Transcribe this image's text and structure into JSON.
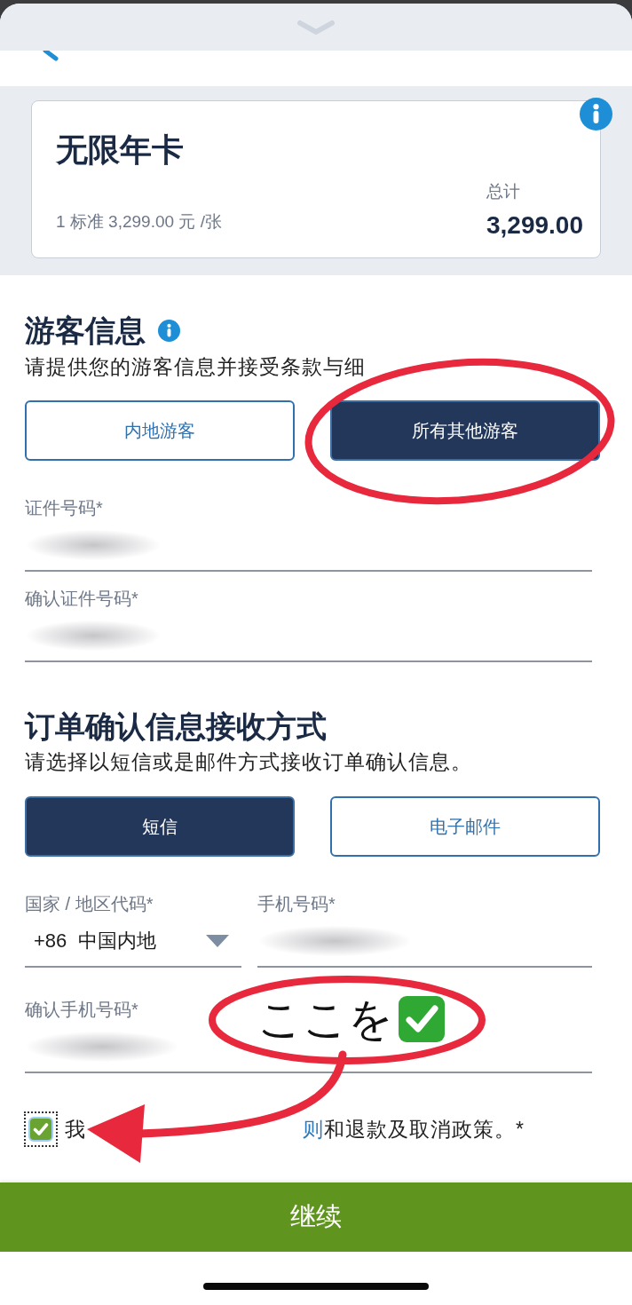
{
  "product_card": {
    "title": "无限年卡",
    "detail": "1 标准 3,299.00 元 /张",
    "total_label": "总计",
    "total": "3,299.00"
  },
  "guest_info": {
    "title": "游客信息",
    "subtitle": "请提供您的游客信息并接受条款与细",
    "options": [
      {
        "label": "内地游客",
        "selected": false
      },
      {
        "label": "所有其他游客",
        "selected": true
      }
    ],
    "fields": [
      {
        "label": "证件号码*",
        "value_redacted": true
      },
      {
        "label": "确认证件号码*",
        "value_redacted": true
      }
    ]
  },
  "confirmation": {
    "title": "订单确认信息接收方式",
    "subtitle": "请选择以短信或是邮件方式接收订单确认信息。",
    "options": [
      {
        "label": "短信",
        "selected": true
      },
      {
        "label": "电子邮件",
        "selected": false
      }
    ],
    "country_code": {
      "label": "国家 / 地区代码*",
      "value": "+86  中国内地"
    },
    "phone": {
      "label": "手机号码*",
      "value_redacted": true
    },
    "confirm_phone": {
      "label": "确认手机号码*",
      "value_redacted": true
    }
  },
  "agreement": {
    "checked": true,
    "focused": true,
    "text_before": "我",
    "link": "则",
    "text_after": "和退款及取消政策。*"
  },
  "continue_button": "继续",
  "annotations": [
    {
      "kind": "ellipse"
    },
    {
      "kind": "ellipse",
      "note": "ここを"
    },
    {
      "kind": "arrow"
    }
  ]
}
